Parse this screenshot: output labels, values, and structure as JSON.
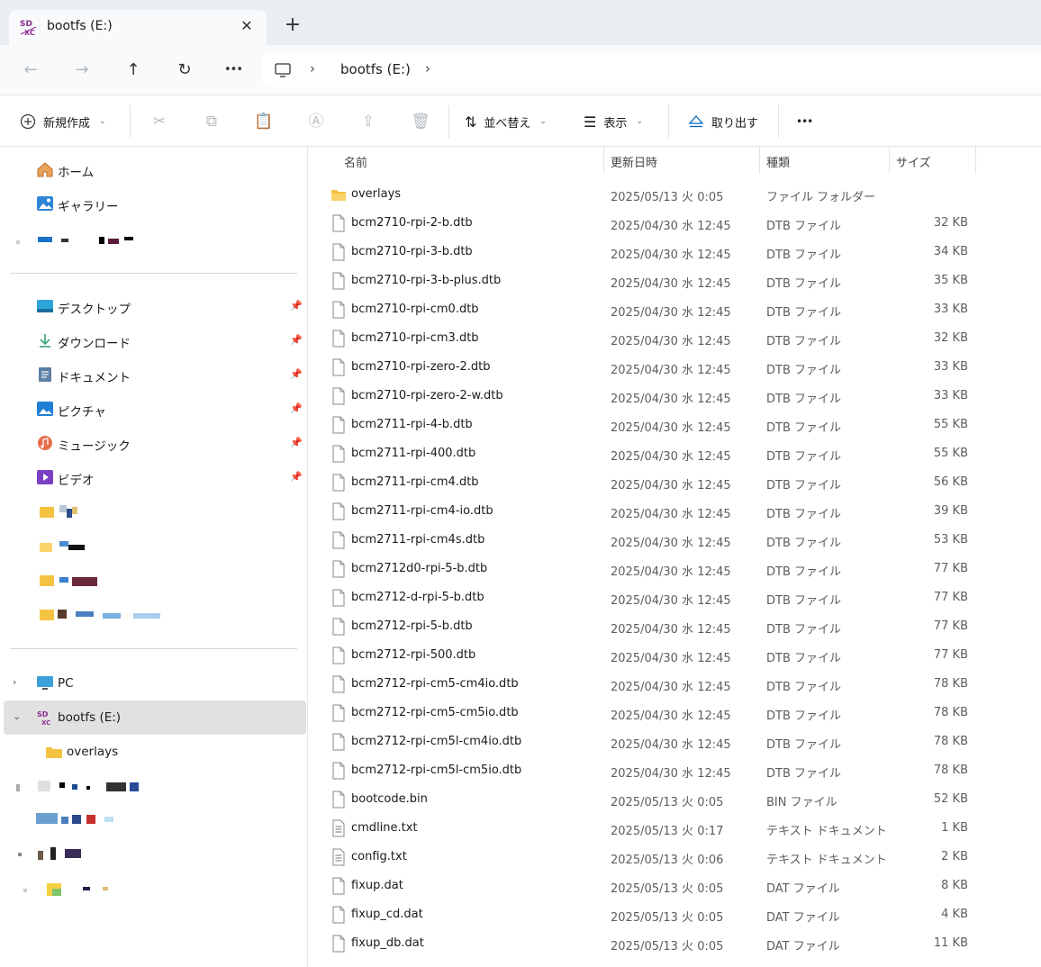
{
  "window": {
    "tab_title": "bootfs (E:)",
    "tab_icon": "sd-card-drive-icon",
    "close_glyph": "✕",
    "new_tab_glyph": "+"
  },
  "nav": {
    "back_glyph": "←",
    "forward_glyph": "→",
    "up_glyph": "↑",
    "refresh_glyph": "↻",
    "more_glyph": "•••",
    "breadcrumb": [
      "bootfs (E:)"
    ],
    "separator_glyph": "›"
  },
  "toolbar": {
    "new_label": "新規作成",
    "sort_label": "並べ替え",
    "view_label": "表示",
    "eject_label": "取り出す",
    "more_glyph": "•••",
    "chevron_glyph": "⌄"
  },
  "sidebar": {
    "home_label": "ホーム",
    "gallery_label": "ギャラリー",
    "quick_access": [
      {
        "label": "デスクトップ",
        "icon": "desktop-icon"
      },
      {
        "label": "ダウンロード",
        "icon": "download-icon"
      },
      {
        "label": "ドキュメント",
        "icon": "documents-icon"
      },
      {
        "label": "ピクチャ",
        "icon": "pictures-icon"
      },
      {
        "label": "ミュージック",
        "icon": "music-icon"
      },
      {
        "label": "ビデオ",
        "icon": "videos-icon"
      }
    ],
    "pc_label": "PC",
    "drive_label": "bootfs (E:)",
    "drive_child_label": "overlays",
    "pin_glyph": "📌",
    "expand_glyph": "›",
    "collapse_glyph": "⌄"
  },
  "columns": {
    "name": "名前",
    "date": "更新日時",
    "type": "種類",
    "size": "サイズ"
  },
  "files": [
    {
      "name": "overlays",
      "date": "2025/05/13 火 0:05",
      "type": "ファイル フォルダー",
      "size": "",
      "kind": "folder"
    },
    {
      "name": "bcm2710-rpi-2-b.dtb",
      "date": "2025/04/30 水 12:45",
      "type": "DTB ファイル",
      "size": "32 KB",
      "kind": "file"
    },
    {
      "name": "bcm2710-rpi-3-b.dtb",
      "date": "2025/04/30 水 12:45",
      "type": "DTB ファイル",
      "size": "34 KB",
      "kind": "file"
    },
    {
      "name": "bcm2710-rpi-3-b-plus.dtb",
      "date": "2025/04/30 水 12:45",
      "type": "DTB ファイル",
      "size": "35 KB",
      "kind": "file"
    },
    {
      "name": "bcm2710-rpi-cm0.dtb",
      "date": "2025/04/30 水 12:45",
      "type": "DTB ファイル",
      "size": "33 KB",
      "kind": "file"
    },
    {
      "name": "bcm2710-rpi-cm3.dtb",
      "date": "2025/04/30 水 12:45",
      "type": "DTB ファイル",
      "size": "32 KB",
      "kind": "file"
    },
    {
      "name": "bcm2710-rpi-zero-2.dtb",
      "date": "2025/04/30 水 12:45",
      "type": "DTB ファイル",
      "size": "33 KB",
      "kind": "file"
    },
    {
      "name": "bcm2710-rpi-zero-2-w.dtb",
      "date": "2025/04/30 水 12:45",
      "type": "DTB ファイル",
      "size": "33 KB",
      "kind": "file"
    },
    {
      "name": "bcm2711-rpi-4-b.dtb",
      "date": "2025/04/30 水 12:45",
      "type": "DTB ファイル",
      "size": "55 KB",
      "kind": "file"
    },
    {
      "name": "bcm2711-rpi-400.dtb",
      "date": "2025/04/30 水 12:45",
      "type": "DTB ファイル",
      "size": "55 KB",
      "kind": "file"
    },
    {
      "name": "bcm2711-rpi-cm4.dtb",
      "date": "2025/04/30 水 12:45",
      "type": "DTB ファイル",
      "size": "56 KB",
      "kind": "file"
    },
    {
      "name": "bcm2711-rpi-cm4-io.dtb",
      "date": "2025/04/30 水 12:45",
      "type": "DTB ファイル",
      "size": "39 KB",
      "kind": "file"
    },
    {
      "name": "bcm2711-rpi-cm4s.dtb",
      "date": "2025/04/30 水 12:45",
      "type": "DTB ファイル",
      "size": "53 KB",
      "kind": "file"
    },
    {
      "name": "bcm2712d0-rpi-5-b.dtb",
      "date": "2025/04/30 水 12:45",
      "type": "DTB ファイル",
      "size": "77 KB",
      "kind": "file"
    },
    {
      "name": "bcm2712-d-rpi-5-b.dtb",
      "date": "2025/04/30 水 12:45",
      "type": "DTB ファイル",
      "size": "77 KB",
      "kind": "file"
    },
    {
      "name": "bcm2712-rpi-5-b.dtb",
      "date": "2025/04/30 水 12:45",
      "type": "DTB ファイル",
      "size": "77 KB",
      "kind": "file"
    },
    {
      "name": "bcm2712-rpi-500.dtb",
      "date": "2025/04/30 水 12:45",
      "type": "DTB ファイル",
      "size": "77 KB",
      "kind": "file"
    },
    {
      "name": "bcm2712-rpi-cm5-cm4io.dtb",
      "date": "2025/04/30 水 12:45",
      "type": "DTB ファイル",
      "size": "78 KB",
      "kind": "file"
    },
    {
      "name": "bcm2712-rpi-cm5-cm5io.dtb",
      "date": "2025/04/30 水 12:45",
      "type": "DTB ファイル",
      "size": "78 KB",
      "kind": "file"
    },
    {
      "name": "bcm2712-rpi-cm5l-cm4io.dtb",
      "date": "2025/04/30 水 12:45",
      "type": "DTB ファイル",
      "size": "78 KB",
      "kind": "file"
    },
    {
      "name": "bcm2712-rpi-cm5l-cm5io.dtb",
      "date": "2025/04/30 水 12:45",
      "type": "DTB ファイル",
      "size": "78 KB",
      "kind": "file"
    },
    {
      "name": "bootcode.bin",
      "date": "2025/05/13 火 0:05",
      "type": "BIN ファイル",
      "size": "52 KB",
      "kind": "file"
    },
    {
      "name": "cmdline.txt",
      "date": "2025/05/13 火 0:17",
      "type": "テキスト ドキュメント",
      "size": "1 KB",
      "kind": "text"
    },
    {
      "name": "config.txt",
      "date": "2025/05/13 火 0:06",
      "type": "テキスト ドキュメント",
      "size": "2 KB",
      "kind": "text"
    },
    {
      "name": "fixup.dat",
      "date": "2025/05/13 火 0:05",
      "type": "DAT ファイル",
      "size": "8 KB",
      "kind": "file"
    },
    {
      "name": "fixup_cd.dat",
      "date": "2025/05/13 火 0:05",
      "type": "DAT ファイル",
      "size": "4 KB",
      "kind": "file"
    },
    {
      "name": "fixup_db.dat",
      "date": "2025/05/13 火 0:05",
      "type": "DAT ファイル",
      "size": "11 KB",
      "kind": "file"
    }
  ],
  "colors": {
    "accent": "#0067c0",
    "folder": "#f5c342",
    "selected": "#e1e1e1"
  }
}
